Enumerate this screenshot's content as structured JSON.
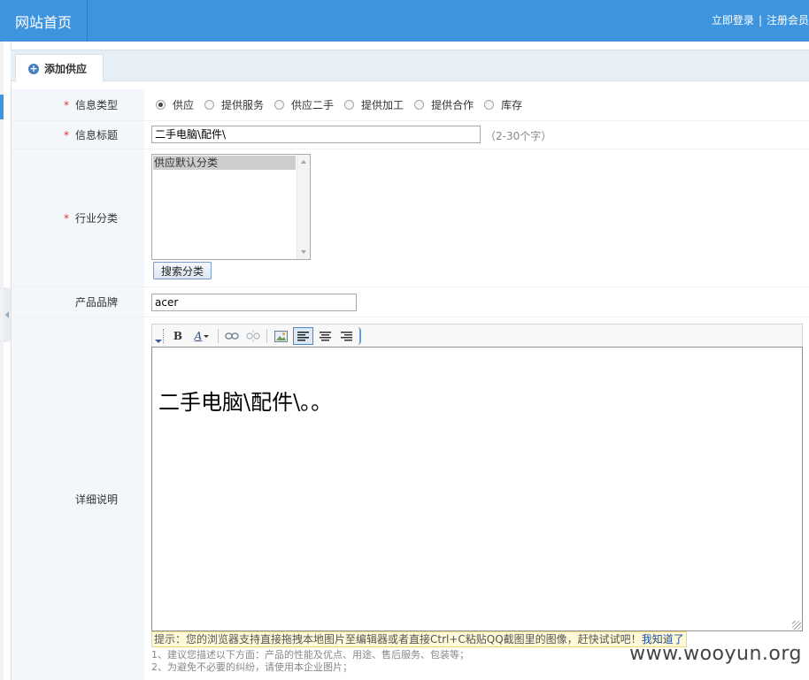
{
  "topbar": {
    "home": "网站首页",
    "login": "立即登录",
    "separator": "|",
    "register": "注册会员"
  },
  "tab": {
    "label": "添加供应",
    "icon": "plus-circle-icon"
  },
  "form": {
    "required_mark": "*",
    "info_type": {
      "label": "信息类型",
      "options": [
        "供应",
        "提供服务",
        "供应二手",
        "提供加工",
        "提供合作",
        "库存"
      ],
      "selected": "供应"
    },
    "title": {
      "label": "信息标题",
      "value": "二手电脑\\配件\\",
      "hint": "（2-30个字）"
    },
    "category": {
      "label": "行业分类",
      "options": [
        "供应默认分类"
      ],
      "search_button": "搜索分类"
    },
    "brand": {
      "label": "产品品牌",
      "value": "acer"
    },
    "detail": {
      "label": "详细说明",
      "toolbar": {
        "bold": "B",
        "font_color": "A"
      },
      "content": "二手电脑\\配件\\。。",
      "tip": "提示：您的浏览器支持直接拖拽本地图片至编辑器或者直接Ctrl+C粘贴QQ截图里的图像，赶快试试吧！",
      "tip_dismiss": "我知道了",
      "notes": [
        "1、建议您描述以下方面：产品的性能及优点、用途、售后服务、包装等；",
        "2、为避免不必要的纠纷，请使用本企业图片；"
      ]
    }
  },
  "watermark": "www.wooyun.org",
  "colors": {
    "topbar_bg": "#3f94de",
    "label_bg": "#f3f7fb",
    "required": "#e0322e",
    "tip_bg": "#fff9d8"
  }
}
